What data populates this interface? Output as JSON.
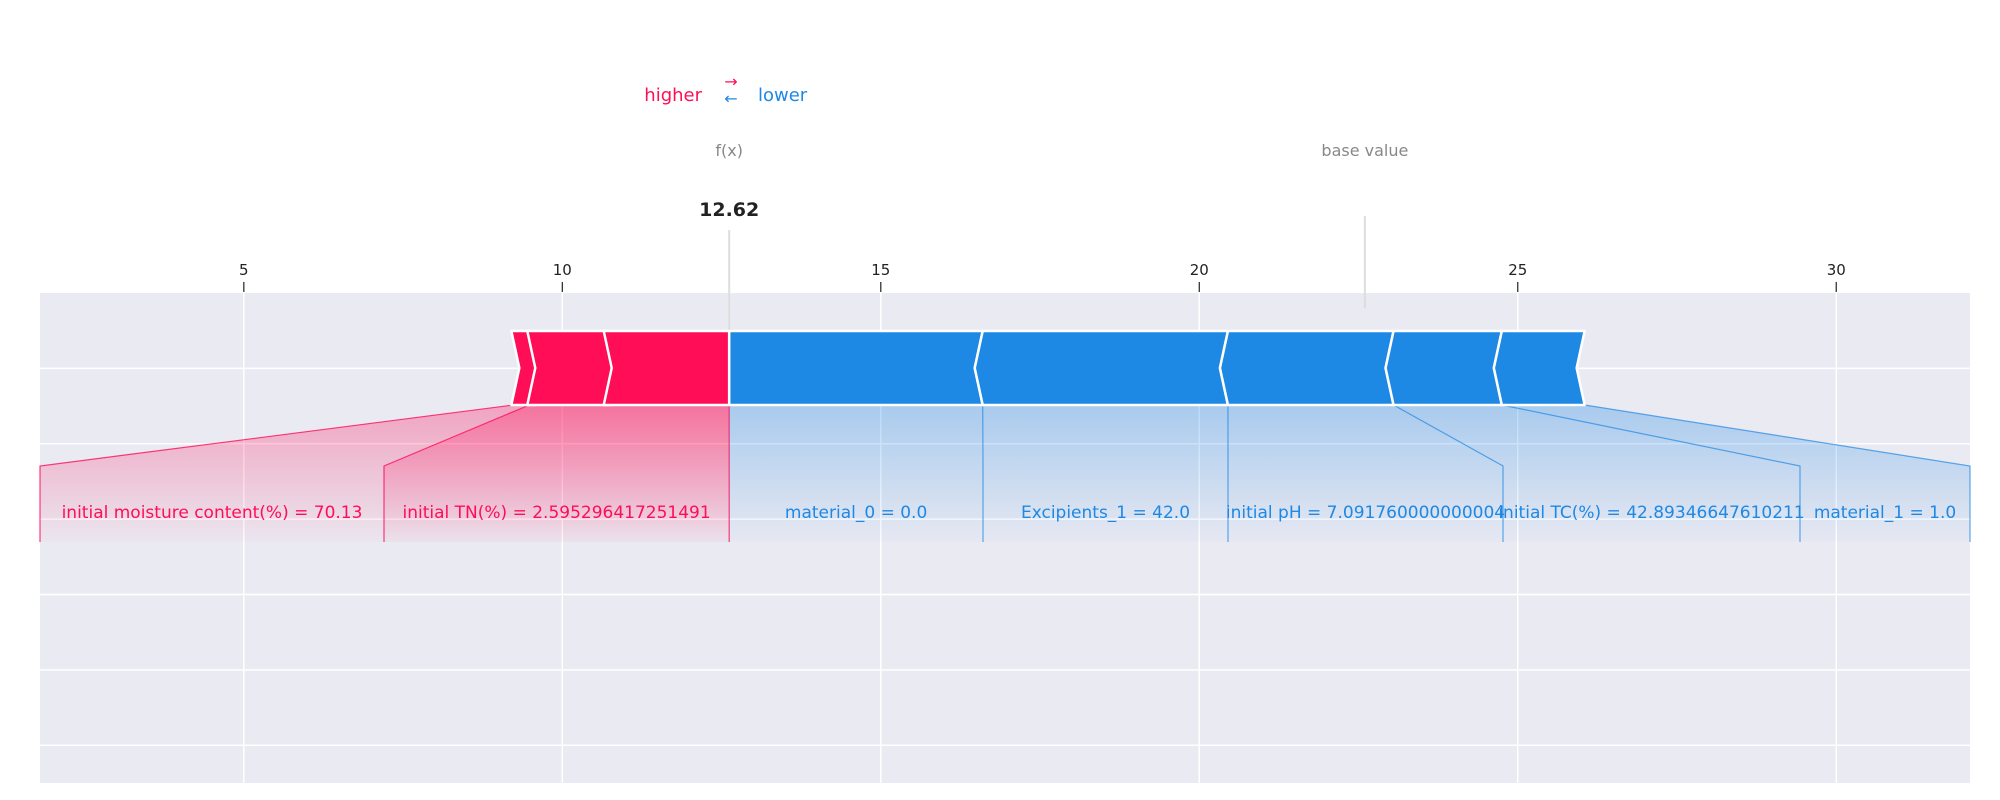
{
  "chart_data": {
    "type": "force",
    "legend": {
      "higher": "higher",
      "lower": "lower",
      "arrow_right": "→",
      "arrow_left": "←"
    },
    "fx_label": "f(x)",
    "fx_value": 12.62,
    "fx_value_label": "12.62",
    "base_label": "base value",
    "base_value": 22.6,
    "xlim": [
      1.8,
      32.1
    ],
    "ticks": [
      5,
      10,
      15,
      20,
      25,
      30
    ],
    "tick_labels": [
      "5",
      "10",
      "15",
      "20",
      "25",
      "30"
    ],
    "positive_features": [
      {
        "label": "initial moisture content(%) = 70.13",
        "start": 9.2,
        "end": 9.45
      },
      {
        "label": "initial TN(%) = 2.595296417251491",
        "start": 9.45,
        "end": 10.65
      },
      {
        "label": "",
        "start": 10.65,
        "end": 12.62
      }
    ],
    "negative_features": [
      {
        "label": "material_0 = 0.0",
        "start": 12.62,
        "end": 16.6
      },
      {
        "label": "Excipients_1 = 42.0",
        "start": 16.6,
        "end": 20.45
      },
      {
        "label": "initial pH = 7.091760000000004",
        "start": 20.45,
        "end": 23.05
      },
      {
        "label": "initial TC(%) = 42.89346647610211",
        "start": 23.05,
        "end": 24.75
      },
      {
        "label": "material_1 = 1.0",
        "start": 24.75,
        "end": 26.05
      }
    ],
    "colors": {
      "higher": "#ff0d57",
      "lower": "#1e88e5",
      "grid_bg": "#eaeaf2",
      "muted": "#888888"
    }
  }
}
